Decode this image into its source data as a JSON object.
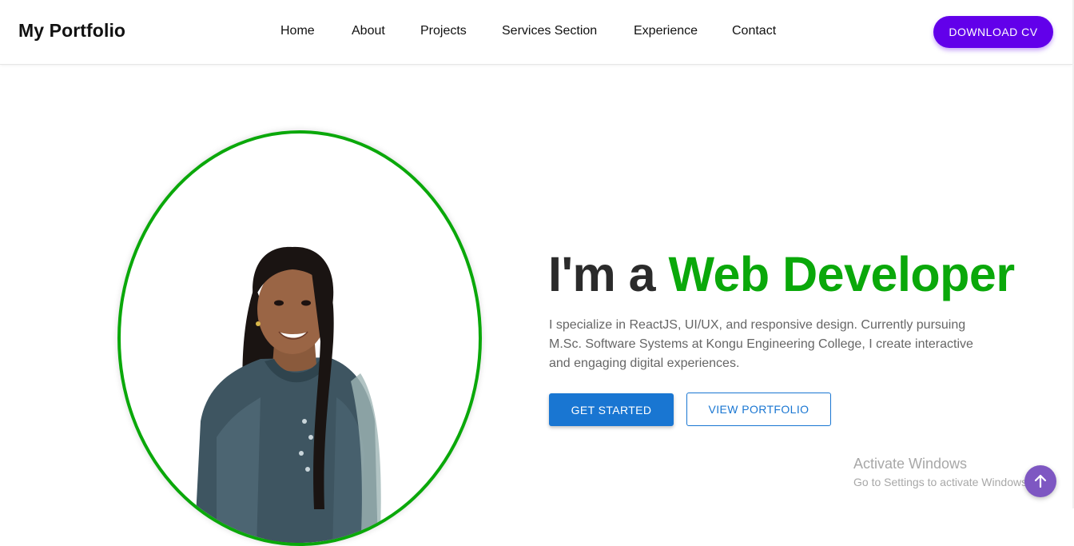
{
  "header": {
    "brand": "My Portfolio",
    "nav": [
      {
        "label": "Home"
      },
      {
        "label": "About"
      },
      {
        "label": "Projects"
      },
      {
        "label": "Services Section"
      },
      {
        "label": "Experience"
      },
      {
        "label": "Contact"
      }
    ],
    "cta_label": "DOWNLOAD CV"
  },
  "hero": {
    "heading_prefix": "I'm a ",
    "heading_highlight": "Web Developer",
    "description": "I specialize in ReactJS, UI/UX, and responsive design. Currently pursuing M.Sc. Software Systems at Kongu Engineering College, I create interactive and engaging digital experiences.",
    "primary_button": "GET STARTED",
    "secondary_button": "VIEW PORTFOLIO"
  },
  "watermark": {
    "title": "Activate Windows",
    "subtitle": "Go to Settings to activate Windows."
  },
  "scroll_top_icon": "arrow-up-icon",
  "colors": {
    "accent_green": "#0aa80a",
    "cta_purple": "#6200ea",
    "primary_blue": "#1976d2",
    "scroll_button": "#7e57c2"
  }
}
